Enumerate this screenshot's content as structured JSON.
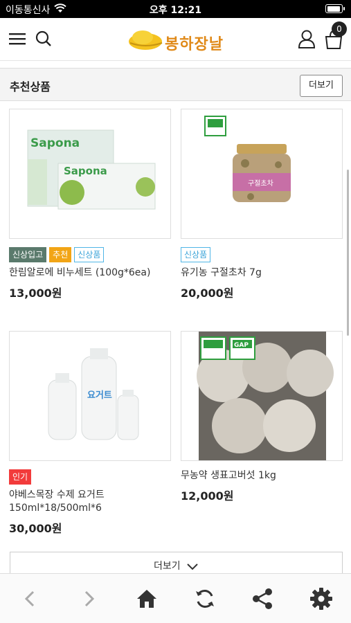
{
  "status": {
    "carrier": "이동통신사",
    "time": "오후 12:21",
    "battery_level": 0.95
  },
  "header": {
    "brand": "봉하장날",
    "cart_count": "0"
  },
  "section": {
    "title": "추천상품",
    "more_label": "더보기"
  },
  "products": [
    {
      "name": "한림알로에 비누세트 (100g*6ea)",
      "price": "13,000원",
      "badges": [
        "신상입고",
        "추천",
        "신상품"
      ],
      "image_text": "Sapona"
    },
    {
      "name": "유기농 구절초차 7g",
      "price": "20,000원",
      "badges": [
        "신상품"
      ],
      "image_text": "구절초차"
    },
    {
      "name": "야베스목장 수제 요거트 150ml*18/500ml*6",
      "price": "30,000원",
      "badges": [
        "인기"
      ],
      "image_text": "요거트"
    },
    {
      "name": "무농약 생표고버섯 1kg",
      "price": "12,000원",
      "badges": [],
      "image_text": "GAP"
    }
  ],
  "load_more_label": "더보기",
  "bottom_nav": [
    "back-icon",
    "forward-icon",
    "home-icon",
    "refresh-icon",
    "share-icon",
    "settings-icon"
  ],
  "colors": {
    "accent": "#f2a516",
    "new_badge": "#4fb5e6",
    "hot_badge": "#f23b3b",
    "new_in_badge": "#5a7a6c"
  }
}
